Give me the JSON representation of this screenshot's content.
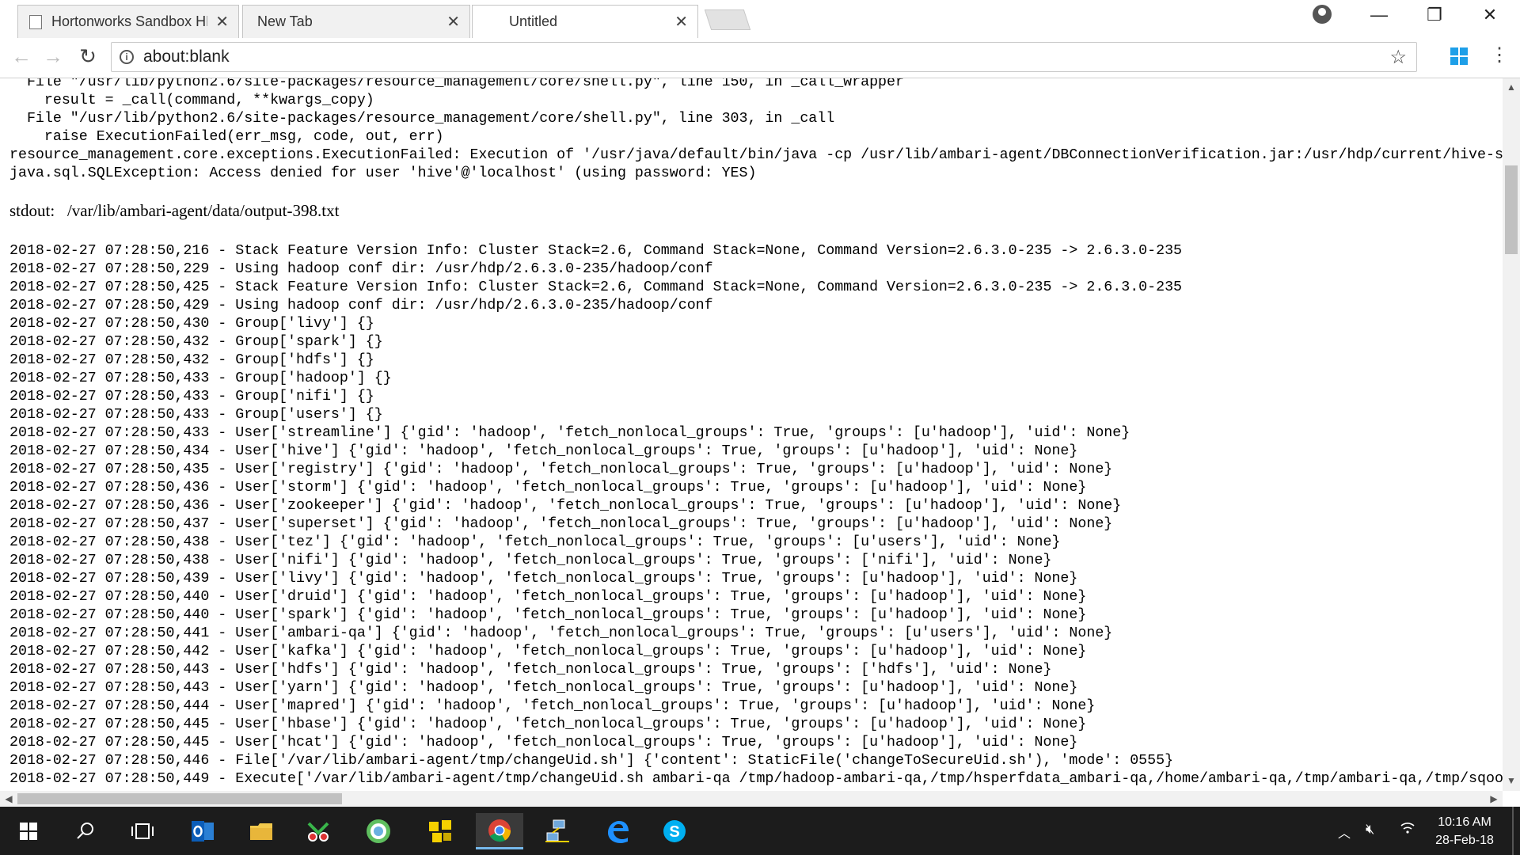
{
  "tabs": [
    {
      "title": "Hortonworks Sandbox HDP",
      "active": false
    },
    {
      "title": "New Tab",
      "active": false
    },
    {
      "title": "Untitled",
      "active": true
    }
  ],
  "tab_close_glyph": "✕",
  "omnibox": {
    "scheme": "about:",
    "path": "blank"
  },
  "traceback": [
    "  File \"/usr/lib/python2.6/site-packages/resource_management/core/shell.py\", line 150, in _call_wrapper",
    "    result = _call(command, **kwargs_copy)",
    "  File \"/usr/lib/python2.6/site-packages/resource_management/core/shell.py\", line 303, in _call",
    "    raise ExecutionFailed(err_msg, code, out, err)",
    "resource_management.core.exceptions.ExecutionFailed: Execution of '/usr/java/default/bin/java -cp /usr/lib/ambari-agent/DBConnectionVerification.jar:/usr/hdp/current/hive-serve",
    "java.sql.SQLException: Access denied for user 'hive'@'localhost' (using password: YES)"
  ],
  "stdout": {
    "label": "stdout:",
    "path": "/var/lib/ambari-agent/data/output-398.txt"
  },
  "log": [
    "2018-02-27 07:28:50,216 - Stack Feature Version Info: Cluster Stack=2.6, Command Stack=None, Command Version=2.6.3.0-235 -> 2.6.3.0-235",
    "2018-02-27 07:28:50,229 - Using hadoop conf dir: /usr/hdp/2.6.3.0-235/hadoop/conf",
    "2018-02-27 07:28:50,425 - Stack Feature Version Info: Cluster Stack=2.6, Command Stack=None, Command Version=2.6.3.0-235 -> 2.6.3.0-235",
    "2018-02-27 07:28:50,429 - Using hadoop conf dir: /usr/hdp/2.6.3.0-235/hadoop/conf",
    "2018-02-27 07:28:50,430 - Group['livy'] {}",
    "2018-02-27 07:28:50,432 - Group['spark'] {}",
    "2018-02-27 07:28:50,432 - Group['hdfs'] {}",
    "2018-02-27 07:28:50,433 - Group['hadoop'] {}",
    "2018-02-27 07:28:50,433 - Group['nifi'] {}",
    "2018-02-27 07:28:50,433 - Group['users'] {}",
    "2018-02-27 07:28:50,433 - User['streamline'] {'gid': 'hadoop', 'fetch_nonlocal_groups': True, 'groups': [u'hadoop'], 'uid': None}",
    "2018-02-27 07:28:50,434 - User['hive'] {'gid': 'hadoop', 'fetch_nonlocal_groups': True, 'groups': [u'hadoop'], 'uid': None}",
    "2018-02-27 07:28:50,435 - User['registry'] {'gid': 'hadoop', 'fetch_nonlocal_groups': True, 'groups': [u'hadoop'], 'uid': None}",
    "2018-02-27 07:28:50,436 - User['storm'] {'gid': 'hadoop', 'fetch_nonlocal_groups': True, 'groups': [u'hadoop'], 'uid': None}",
    "2018-02-27 07:28:50,436 - User['zookeeper'] {'gid': 'hadoop', 'fetch_nonlocal_groups': True, 'groups': [u'hadoop'], 'uid': None}",
    "2018-02-27 07:28:50,437 - User['superset'] {'gid': 'hadoop', 'fetch_nonlocal_groups': True, 'groups': [u'hadoop'], 'uid': None}",
    "2018-02-27 07:28:50,438 - User['tez'] {'gid': 'hadoop', 'fetch_nonlocal_groups': True, 'groups': [u'users'], 'uid': None}",
    "2018-02-27 07:28:50,438 - User['nifi'] {'gid': 'hadoop', 'fetch_nonlocal_groups': True, 'groups': ['nifi'], 'uid': None}",
    "2018-02-27 07:28:50,439 - User['livy'] {'gid': 'hadoop', 'fetch_nonlocal_groups': True, 'groups': [u'hadoop'], 'uid': None}",
    "2018-02-27 07:28:50,440 - User['druid'] {'gid': 'hadoop', 'fetch_nonlocal_groups': True, 'groups': [u'hadoop'], 'uid': None}",
    "2018-02-27 07:28:50,440 - User['spark'] {'gid': 'hadoop', 'fetch_nonlocal_groups': True, 'groups': [u'hadoop'], 'uid': None}",
    "2018-02-27 07:28:50,441 - User['ambari-qa'] {'gid': 'hadoop', 'fetch_nonlocal_groups': True, 'groups': [u'users'], 'uid': None}",
    "2018-02-27 07:28:50,442 - User['kafka'] {'gid': 'hadoop', 'fetch_nonlocal_groups': True, 'groups': [u'hadoop'], 'uid': None}",
    "2018-02-27 07:28:50,443 - User['hdfs'] {'gid': 'hadoop', 'fetch_nonlocal_groups': True, 'groups': ['hdfs'], 'uid': None}",
    "2018-02-27 07:28:50,443 - User['yarn'] {'gid': 'hadoop', 'fetch_nonlocal_groups': True, 'groups': [u'hadoop'], 'uid': None}",
    "2018-02-27 07:28:50,444 - User['mapred'] {'gid': 'hadoop', 'fetch_nonlocal_groups': True, 'groups': [u'hadoop'], 'uid': None}",
    "2018-02-27 07:28:50,445 - User['hbase'] {'gid': 'hadoop', 'fetch_nonlocal_groups': True, 'groups': [u'hadoop'], 'uid': None}",
    "2018-02-27 07:28:50,445 - User['hcat'] {'gid': 'hadoop', 'fetch_nonlocal_groups': True, 'groups': [u'hadoop'], 'uid': None}",
    "2018-02-27 07:28:50,446 - File['/var/lib/ambari-agent/tmp/changeUid.sh'] {'content': StaticFile('changeToSecureUid.sh'), 'mode': 0555}",
    "2018-02-27 07:28:50,449 - Execute['/var/lib/ambari-agent/tmp/changeUid.sh ambari-qa /tmp/hadoop-ambari-qa,/tmp/hsperfdata_ambari-qa,/home/ambari-qa,/tmp/ambari-qa,/tmp/sqoop-am"
  ],
  "taskbar": {
    "icons": [
      "windows-start-icon",
      "search-icon",
      "task-view-icon",
      "outlook-icon",
      "file-explorer-icon",
      "snipping-tool-icon",
      "messenger-icon",
      "puzzle-app-icon",
      "chrome-icon",
      "network-app-icon",
      "edge-icon",
      "skype-icon"
    ],
    "clock_time": "10:16 AM",
    "clock_date": "28-Feb-18"
  },
  "colors": {
    "accent": "#1e9fe8",
    "taskbar": "#1c1c1c"
  }
}
